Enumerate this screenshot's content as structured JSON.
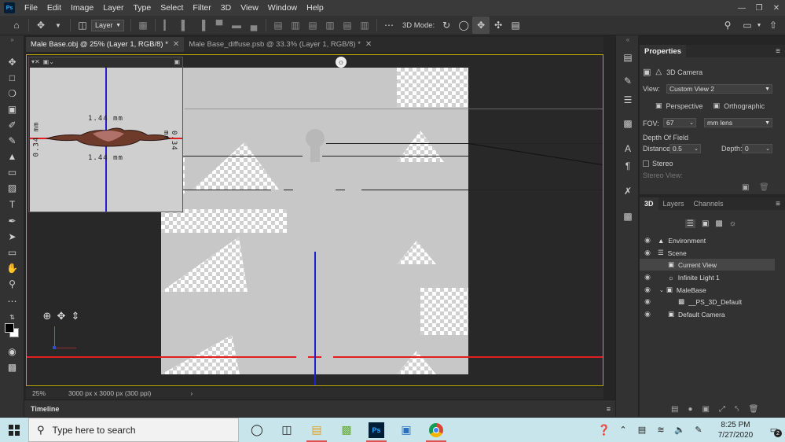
{
  "menubar": {
    "logo": "Ps",
    "items": [
      "File",
      "Edit",
      "Image",
      "Layer",
      "Type",
      "Select",
      "Filter",
      "3D",
      "View",
      "Window",
      "Help"
    ]
  },
  "optionsbar": {
    "layer_select": "Layer",
    "mode3d_label": "3D Mode:"
  },
  "tabs": [
    {
      "label": "Male Base.obj @ 25% (Layer 1, RGB/8) *",
      "active": true
    },
    {
      "label": "Male Base_diffuse.psb @ 33.3% (Layer 1, RGB/8) *",
      "active": false
    }
  ],
  "minicam": {
    "dim_top": "1.44 mm",
    "dim_bottom": "1.44 mm",
    "dim_left": "0.34 mm",
    "dim_right": "0.34 mm"
  },
  "status": {
    "zoom": "25%",
    "doc_info": "3000 px x 3000 px (300 ppi)"
  },
  "timeline": {
    "label": "Timeline"
  },
  "properties": {
    "tab": "Properties",
    "header": "3D Camera",
    "view_label": "View:",
    "view_value": "Custom View 2",
    "perspective": "Perspective",
    "orthographic": "Orthographic",
    "fov_label": "FOV:",
    "fov_value": "67",
    "fov_unit": "mm lens",
    "dof_label": "Depth Of Field",
    "distance_label": "Distance:",
    "distance_value": "0.5",
    "depth_label": "Depth:",
    "depth_value": "0",
    "stereo_label": "Stereo",
    "stereo_view_label": "Stereo View:"
  },
  "panel3d": {
    "tabs": [
      "3D",
      "Layers",
      "Channels"
    ],
    "tree": [
      {
        "label": "Environment",
        "icon": "environment-icon",
        "indent": 0
      },
      {
        "label": "Scene",
        "icon": "scene-icon",
        "indent": 0
      },
      {
        "label": "Current View",
        "icon": "camera-icon",
        "indent": 1,
        "selected": true
      },
      {
        "label": "Infinite Light 1",
        "icon": "light-icon",
        "indent": 1
      },
      {
        "label": "MaleBase",
        "icon": "mesh-icon",
        "indent": 1
      },
      {
        "label": "__PS_3D_Default",
        "icon": "material-icon",
        "indent": 2
      },
      {
        "label": "Default Camera",
        "icon": "camera-icon",
        "indent": 1
      }
    ]
  },
  "taskbar": {
    "search_placeholder": "Type here to search",
    "time": "8:25 PM",
    "date": "7/27/2020",
    "notification_count": "2"
  },
  "colors": {
    "accent_border": "#b8a800",
    "x_axis": "#e02020",
    "y_axis": "#2020d0"
  }
}
